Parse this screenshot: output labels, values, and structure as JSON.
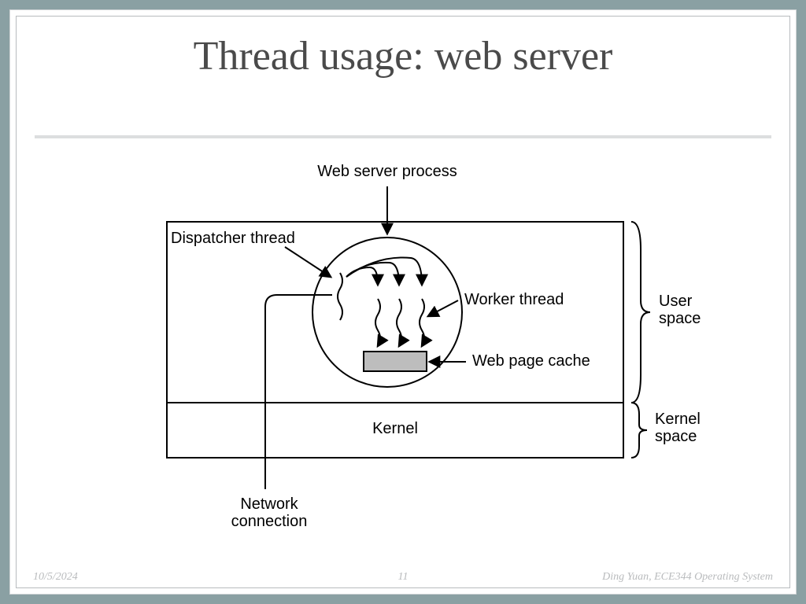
{
  "slide": {
    "title": "Thread usage: web server",
    "labels": {
      "web_server_process": "Web server process",
      "dispatcher_thread": "Dispatcher thread",
      "worker_thread": "Worker thread",
      "web_page_cache": "Web page cache",
      "kernel": "Kernel",
      "user_space": "User\nspace",
      "kernel_space": "Kernel\nspace",
      "network_connection": "Network\nconnection"
    }
  },
  "footer": {
    "date": "10/5/2024",
    "page": "11",
    "author": "Ding Yuan, ECE344 Operating System"
  }
}
